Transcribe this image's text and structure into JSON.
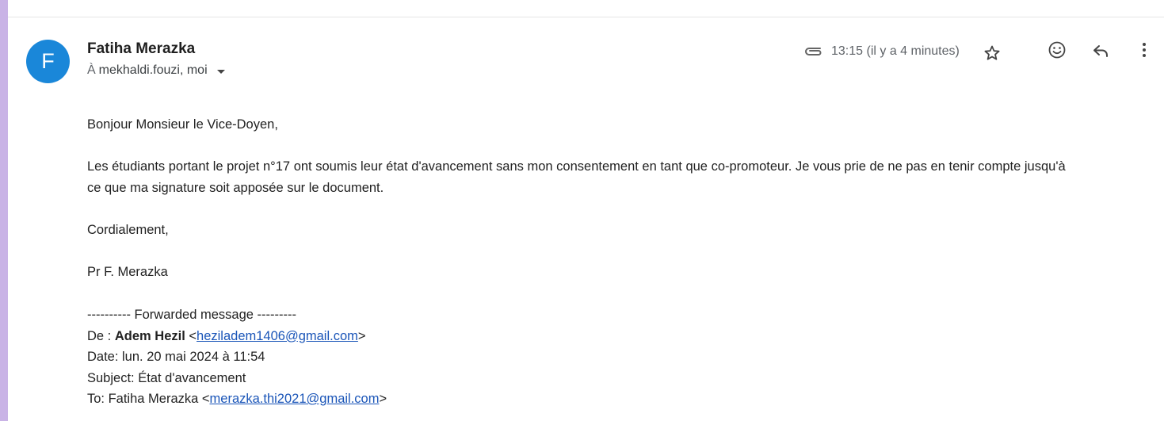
{
  "sender": {
    "initial": "F",
    "name": "Fatiha Merazka",
    "to_prefix": "À",
    "recipients": "mekhaldi.fouzi, moi"
  },
  "header": {
    "time": "13:15 (il y a 4 minutes)",
    "icons": [
      "attachment-icon",
      "star-icon",
      "emoji-icon",
      "reply-icon",
      "more-vert-icon"
    ]
  },
  "message": {
    "greeting": "Bonjour Monsieur le Vice-Doyen,",
    "paragraph_line1": "Les étudiants portant le projet n°17 ont soumis leur état d'avancement sans mon consentement en tant que co-promoteur. Je vous prie de ne pas en tenir compte jusqu'à",
    "paragraph_line2": "ce que ma signature soit apposée sur le document.",
    "closing": "Cordialement,",
    "signature": "Pr F. Merazka"
  },
  "forwarded": {
    "header": "---------- Forwarded message ---------",
    "from_label": "De : ",
    "from_name": "Adem Hezil",
    "from_email": "heziladem1406@gmail.com",
    "date_line": "Date: lun. 20 mai 2024 à 11:54",
    "subject_line": "Subject: État d'avancement",
    "to_label": "To: Fatiha Merazka ",
    "to_email": "merazka.thi2021@gmail.com"
  },
  "colors": {
    "avatar": "#1a87d9",
    "accent": "#c9b3e6",
    "link": "#1a55b8"
  }
}
